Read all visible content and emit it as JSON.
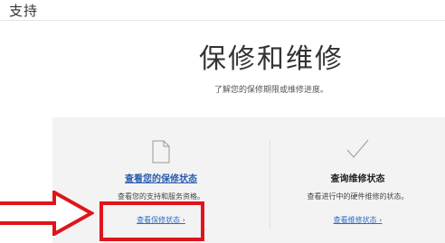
{
  "header": {
    "title": "支持"
  },
  "hero": {
    "title": "保修和维修",
    "subtitle": "了解您的保修期限或维修进度。"
  },
  "cards": [
    {
      "icon": "document-icon",
      "heading": "查看您的保修状态",
      "description": "查看您的支持和服务资格。",
      "link": "查看保修状态 ›"
    },
    {
      "icon": "checkmark-icon",
      "heading": "查询维修状态",
      "description": "查看进行中的硬件维修的状态。",
      "link": "查看维修状态 ›"
    }
  ],
  "annotation": {
    "highlight_color": "#e0141b",
    "arrow_color": "#e0141b"
  },
  "colors": {
    "link": "#2a6dc8",
    "panel_bg": "#f3f3f3"
  }
}
